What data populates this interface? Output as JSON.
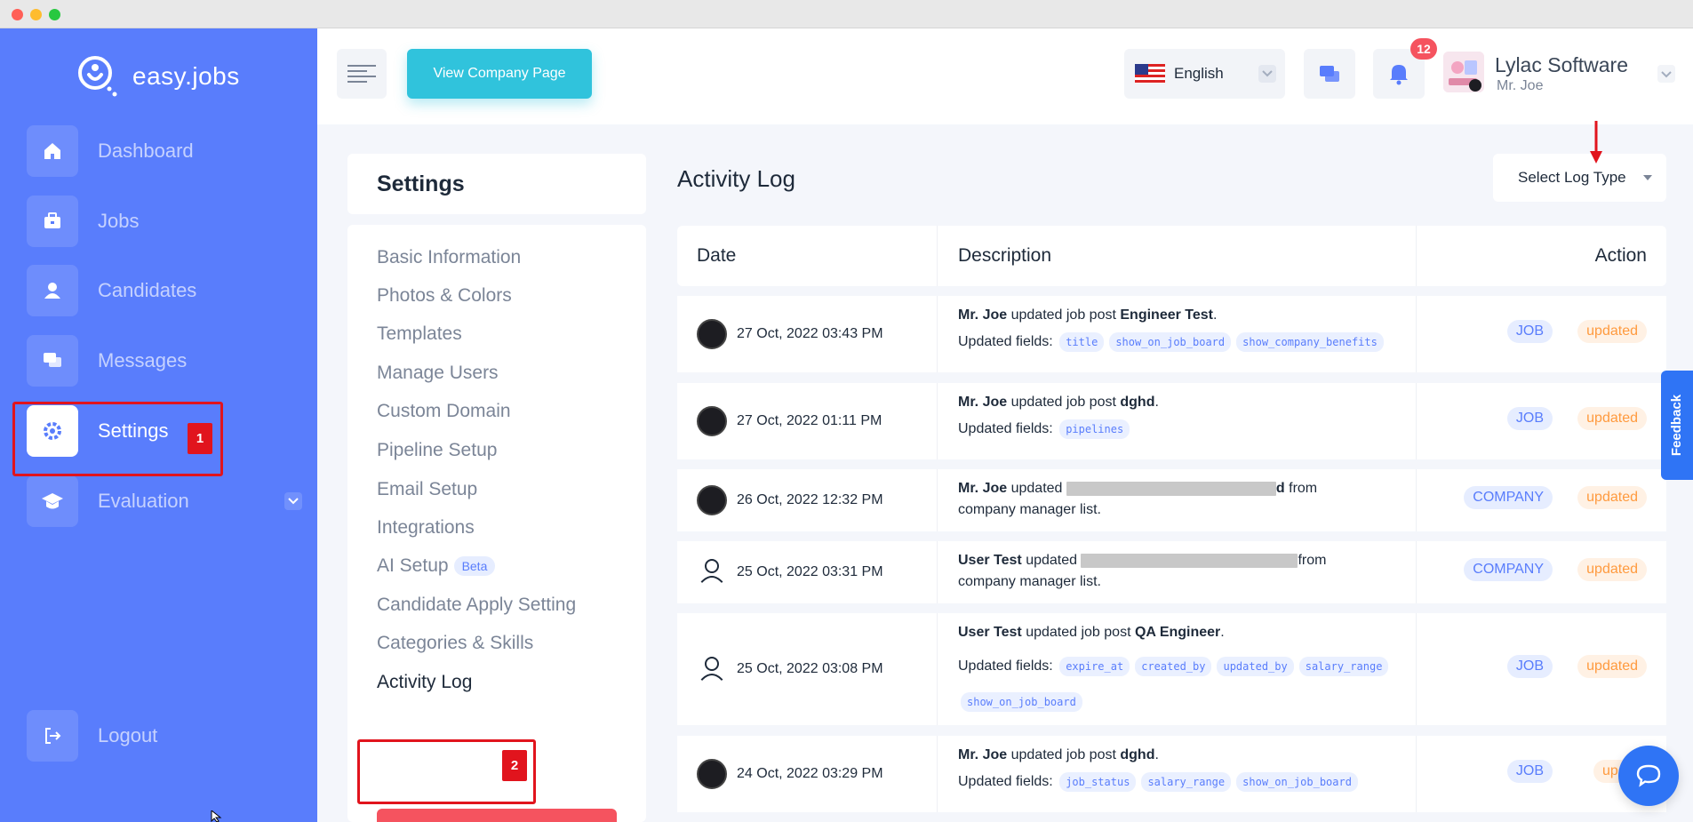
{
  "brand": {
    "name": "easy.jobs"
  },
  "sidebar": {
    "items": [
      {
        "label": "Dashboard",
        "icon": "home-icon"
      },
      {
        "label": "Jobs",
        "icon": "briefcase-icon"
      },
      {
        "label": "Candidates",
        "icon": "user-icon"
      },
      {
        "label": "Messages",
        "icon": "chat-icon"
      },
      {
        "label": "Settings",
        "icon": "gear-icon",
        "active": true
      },
      {
        "label": "Evaluation",
        "icon": "graduation-cap-icon"
      }
    ],
    "logout": "Logout"
  },
  "annotations": {
    "step1": "1",
    "step2": "2"
  },
  "topbar": {
    "view_company": "View Company Page",
    "language": "English",
    "notifications_count": "12",
    "company_name": "Lylac Software",
    "user_name": "Mr. Joe"
  },
  "settings": {
    "title": "Settings",
    "menu": [
      "Basic Information",
      "Photos & Colors",
      "Templates",
      "Manage Users",
      "Custom Domain",
      "Pipeline Setup",
      "Email Setup",
      "Integrations",
      "AI Setup",
      "Candidate Apply Setting",
      "Categories & Skills",
      "Activity Log"
    ],
    "beta_label": "Beta"
  },
  "activity": {
    "title": "Activity Log",
    "select_placeholder": "Select Log Type",
    "columns": {
      "date": "Date",
      "description": "Description",
      "action": "Action"
    },
    "fields_label": "Updated fields:",
    "rows": [
      {
        "date": "27 Oct, 2022 03:43 PM",
        "actor": "Mr. Joe",
        "text": "updated job post",
        "target": "Engineer Test",
        "fields": [
          "title",
          "show_on_job_board",
          "show_company_benefits"
        ],
        "type": "JOB",
        "action": "updated"
      },
      {
        "date": "27 Oct, 2022 01:11 PM",
        "actor": "Mr. Joe",
        "text": "updated job post",
        "target": "dghd",
        "fields": [
          "pipelines"
        ],
        "type": "JOB",
        "action": "updated"
      },
      {
        "date": "26 Oct, 2022 12:32 PM",
        "actor": "Mr. Joe",
        "text": "updated",
        "tail_char": "d",
        "tail": "from",
        "line2": "company manager list.",
        "type": "COMPANY",
        "action": "updated"
      },
      {
        "date": "25 Oct, 2022 03:31 PM",
        "actor": "User Test",
        "text": "updated",
        "tail": "from",
        "line2": "company manager list.",
        "type": "COMPANY",
        "action": "updated"
      },
      {
        "date": "25 Oct, 2022 03:08 PM",
        "actor": "User Test",
        "text": "updated job post",
        "target": "QA Engineer",
        "fields": [
          "expire_at",
          "created_by",
          "updated_by",
          "salary_range",
          "show_on_job_board"
        ],
        "type": "JOB",
        "action": "updated"
      },
      {
        "date": "24 Oct, 2022 03:29 PM",
        "actor": "Mr. Joe",
        "text": "updated job post",
        "target": "dghd",
        "fields": [
          "job_status",
          "salary_range",
          "show_on_job_board"
        ],
        "type": "JOB",
        "action": "updat"
      }
    ]
  },
  "widgets": {
    "feedback": "Feedback"
  },
  "colors": {
    "sidebar": "#597dfc",
    "accent_cyan": "#30c3dc",
    "annotation_red": "#e1141d",
    "tag_blue": "#597dfc",
    "action_orange": "#ff9a3e"
  }
}
